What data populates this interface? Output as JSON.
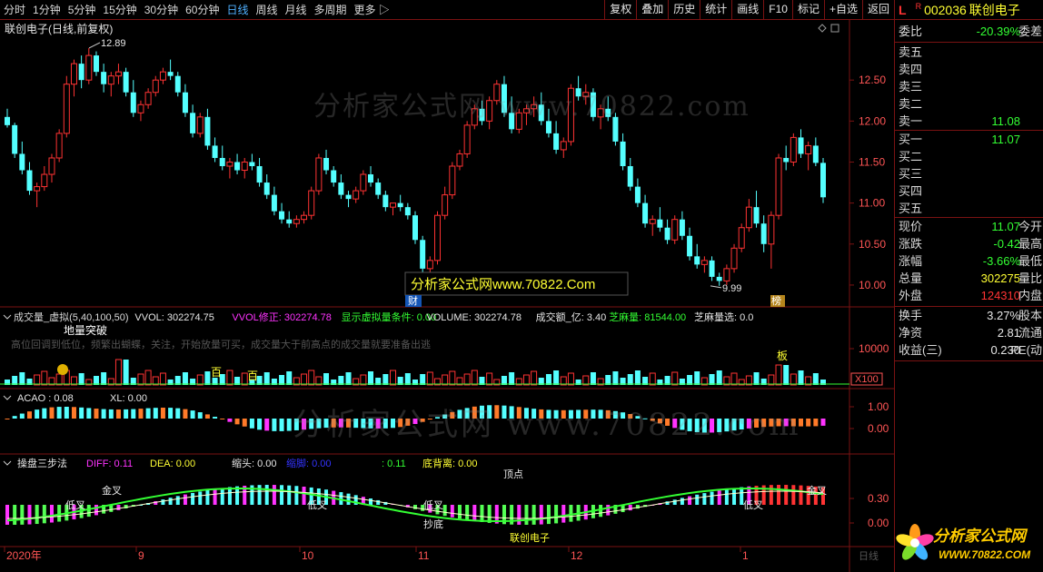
{
  "toolbar": {
    "periods": [
      "分时",
      "1分钟",
      "5分钟",
      "15分钟",
      "30分钟",
      "60分钟",
      "日线",
      "周线",
      "月线",
      "多周期",
      "更多 ▷"
    ],
    "active_period": "日线",
    "tools": [
      "复权",
      "叠加",
      "历史",
      "统计",
      "画线",
      "F10",
      "标记",
      "+自选",
      "返回"
    ]
  },
  "main": {
    "title": "联创电子(日线,前复权)",
    "high_label": "12.89",
    "low_label": "9.99",
    "price_ticks": [
      "12.50",
      "12.00",
      "11.50",
      "11.00",
      "10.50",
      "10.00"
    ],
    "banner": "分析家公式网www.70822.Com",
    "marker_cai": "财",
    "marker_bang": "榜",
    "watermark": "分析家公式网  www.70822.com"
  },
  "volume_panel": {
    "indicator_name": "成交量_虚拟(5,40,100,50)",
    "values": [
      {
        "label": "VVOL: 302274.75",
        "color": "#e6e6e6"
      },
      {
        "label": "VVOL修正: 302274.78",
        "color": "#ff33ff"
      },
      {
        "label": "显示虚拟量条件: 0.00",
        "color": "#33ff33"
      },
      {
        "label": "VOLUME: 302274.78",
        "color": "#e6e6e6"
      },
      {
        "label": "成交额_亿: 3.40",
        "color": "#e6e6e6"
      },
      {
        "label": "芝麻量: 81544.00",
        "color": "#33ff33"
      },
      {
        "label": "芝麻量选: 0.0",
        "color": "#e6e6e6"
      }
    ],
    "note": "高位回调到低位，频繁出蝴蝶，关注，开始放量可买，成交量大于前高点的成交量就要准备出逃",
    "tag_breakout": "地量突破",
    "tag_bai": "百",
    "tag_ban": "板",
    "tick_10000": "10000",
    "unit": "X100"
  },
  "acao_panel": {
    "name": "ACAO : 0.08",
    "xl": "XL: 0.00",
    "ticks": [
      "1.00",
      "0.00"
    ],
    "watermark": "分析家公式网  www.70822.com"
  },
  "macd_panel": {
    "name": "操盘三步法",
    "values": [
      {
        "label": "DIFF: 0.11",
        "color": "#ff33ff"
      },
      {
        "label": "DEA: 0.00",
        "color": "#ffff33"
      },
      {
        "label": "缩头: 0.00",
        "color": "#e6e6e6"
      },
      {
        "label": "缩脚: 0.00",
        "color": "#3333ff"
      },
      {
        "label": ": 0.11",
        "color": "#33ff33"
      },
      {
        "label": "底背离: 0.00",
        "color": "#ffff33"
      }
    ],
    "ticks": [
      "0.30",
      "0.00"
    ],
    "labels": {
      "die_cha": "低叉",
      "jin_cha": "金叉",
      "chao_di": "抄底",
      "ding": "顶点"
    },
    "stock_name": "联创电子"
  },
  "date_axis": {
    "labels": [
      "2020年",
      "9",
      "10",
      "11",
      "12",
      "1"
    ],
    "right": "日线"
  },
  "right_panel": {
    "code": "002036",
    "name": "联创电子",
    "flag_l": "L",
    "flag_r": "R",
    "weibi": {
      "label": "委比",
      "value": "-20.39%",
      "label2": "委差"
    },
    "asks": [
      {
        "label": "卖五",
        "value": ""
      },
      {
        "label": "卖四",
        "value": ""
      },
      {
        "label": "卖三",
        "value": ""
      },
      {
        "label": "卖二",
        "value": ""
      },
      {
        "label": "卖一",
        "value": "11.08"
      }
    ],
    "bids": [
      {
        "label": "买一",
        "value": "11.07"
      },
      {
        "label": "买二",
        "value": ""
      },
      {
        "label": "买三",
        "value": ""
      },
      {
        "label": "买四",
        "value": ""
      },
      {
        "label": "买五",
        "value": ""
      }
    ],
    "quote": [
      {
        "label": "现价",
        "value": "11.07",
        "label2": "今开",
        "color": "#33ff33"
      },
      {
        "label": "涨跌",
        "value": "-0.42",
        "label2": "最高",
        "color": "#33ff33"
      },
      {
        "label": "涨幅",
        "value": "-3.66%",
        "label2": "最低",
        "color": "#33ff33"
      },
      {
        "label": "总量",
        "value": "302275",
        "label2": "量比",
        "color": "#ffff33"
      },
      {
        "label": "外盘",
        "value": "124310",
        "label2": "内盘",
        "color": "#ff3333"
      }
    ],
    "fund": [
      {
        "label": "换手",
        "value": "3.27%",
        "label2": "股本",
        "color": "#e6e6e6"
      },
      {
        "label": "净资",
        "value": "2.81",
        "label2": "流通",
        "color": "#e6e6e6"
      },
      {
        "label": "收益(三)",
        "value": "0.230",
        "label2": "PE(动",
        "color": "#e6e6e6"
      }
    ],
    "logo_text": "分析家公式网",
    "logo_url": "WWW.70822.COM"
  },
  "colors": {
    "up": "#ff3333",
    "down": "#54ffff",
    "border": "#7a1212",
    "accent": "#4fb0ff"
  },
  "chart_data": {
    "type": "candlestick",
    "ylim": [
      9.8,
      13.1
    ],
    "ohlc": [
      [
        12.05,
        12.15,
        11.92,
        11.95
      ],
      [
        11.95,
        11.98,
        11.55,
        11.6
      ],
      [
        11.6,
        11.75,
        11.35,
        11.4
      ],
      [
        11.4,
        11.5,
        11.1,
        11.15
      ],
      [
        11.15,
        11.25,
        10.95,
        11.2
      ],
      [
        11.2,
        11.45,
        11.15,
        11.35
      ],
      [
        11.35,
        11.6,
        11.25,
        11.55
      ],
      [
        11.55,
        11.9,
        11.5,
        11.85
      ],
      [
        11.85,
        12.55,
        11.8,
        12.45
      ],
      [
        12.45,
        12.75,
        12.3,
        12.7
      ],
      [
        12.7,
        12.8,
        12.4,
        12.5
      ],
      [
        12.5,
        12.89,
        12.45,
        12.8
      ],
      [
        12.8,
        12.85,
        12.55,
        12.6
      ],
      [
        12.6,
        12.7,
        12.35,
        12.45
      ],
      [
        12.45,
        12.6,
        12.3,
        12.55
      ],
      [
        12.55,
        12.7,
        12.45,
        12.6
      ],
      [
        12.6,
        12.65,
        12.3,
        12.35
      ],
      [
        12.35,
        12.5,
        12.05,
        12.1
      ],
      [
        12.1,
        12.25,
        12.0,
        12.2
      ],
      [
        12.2,
        12.4,
        12.15,
        12.35
      ],
      [
        12.35,
        12.55,
        12.3,
        12.5
      ],
      [
        12.5,
        12.65,
        12.45,
        12.6
      ],
      [
        12.6,
        12.75,
        12.5,
        12.55
      ],
      [
        12.55,
        12.6,
        12.3,
        12.35
      ],
      [
        12.35,
        12.45,
        12.05,
        12.1
      ],
      [
        12.1,
        12.2,
        11.8,
        11.85
      ],
      [
        11.85,
        12.1,
        11.8,
        12.05
      ],
      [
        12.05,
        12.15,
        11.65,
        11.7
      ],
      [
        11.7,
        11.8,
        11.5,
        11.55
      ],
      [
        11.55,
        11.7,
        11.4,
        11.45
      ],
      [
        11.45,
        11.55,
        11.3,
        11.5
      ],
      [
        11.5,
        11.6,
        11.35,
        11.4
      ],
      [
        11.4,
        11.55,
        11.3,
        11.5
      ],
      [
        11.5,
        11.6,
        11.4,
        11.45
      ],
      [
        11.45,
        11.55,
        11.2,
        11.25
      ],
      [
        11.25,
        11.35,
        11.05,
        11.1
      ],
      [
        11.1,
        11.2,
        10.85,
        10.9
      ],
      [
        10.9,
        11.0,
        10.75,
        10.8
      ],
      [
        10.8,
        10.9,
        10.7,
        10.75
      ],
      [
        10.75,
        10.85,
        10.7,
        10.8
      ],
      [
        10.8,
        10.9,
        10.75,
        10.85
      ],
      [
        10.85,
        11.2,
        10.8,
        11.15
      ],
      [
        11.15,
        11.6,
        11.1,
        11.55
      ],
      [
        11.55,
        11.65,
        11.35,
        11.4
      ],
      [
        11.4,
        11.45,
        11.2,
        11.25
      ],
      [
        11.25,
        11.35,
        11.05,
        11.1
      ],
      [
        11.1,
        11.15,
        10.95,
        11.05
      ],
      [
        11.05,
        11.2,
        11.0,
        11.15
      ],
      [
        11.15,
        11.4,
        11.1,
        11.35
      ],
      [
        11.35,
        11.45,
        11.2,
        11.25
      ],
      [
        11.25,
        11.3,
        11.05,
        11.1
      ],
      [
        11.1,
        11.15,
        10.9,
        10.95
      ],
      [
        10.95,
        11.0,
        10.85,
        11.0
      ],
      [
        11.0,
        11.1,
        10.9,
        10.95
      ],
      [
        10.95,
        11.0,
        10.8,
        10.85
      ],
      [
        10.85,
        10.9,
        10.5,
        10.55
      ],
      [
        10.55,
        10.6,
        10.15,
        10.2
      ],
      [
        10.2,
        10.35,
        10.1,
        10.3
      ],
      [
        10.3,
        10.9,
        10.25,
        10.85
      ],
      [
        10.85,
        11.2,
        10.8,
        11.1
      ],
      [
        11.1,
        11.5,
        11.05,
        11.45
      ],
      [
        11.45,
        11.65,
        11.4,
        11.6
      ],
      [
        11.6,
        12.0,
        11.55,
        11.95
      ],
      [
        11.95,
        12.2,
        11.9,
        12.15
      ],
      [
        12.15,
        12.25,
        11.95,
        12.0
      ],
      [
        12.0,
        12.3,
        11.9,
        12.25
      ],
      [
        12.25,
        12.5,
        12.2,
        12.45
      ],
      [
        12.45,
        12.55,
        12.05,
        12.1
      ],
      [
        12.1,
        12.3,
        11.85,
        11.9
      ],
      [
        11.9,
        12.15,
        11.85,
        12.1
      ],
      [
        12.1,
        12.2,
        11.95,
        12.15
      ],
      [
        12.15,
        12.3,
        12.05,
        12.2
      ],
      [
        12.2,
        12.35,
        11.95,
        12.0
      ],
      [
        12.0,
        12.15,
        11.8,
        11.85
      ],
      [
        11.85,
        12.0,
        11.6,
        11.65
      ],
      [
        11.65,
        11.8,
        11.55,
        11.75
      ],
      [
        11.75,
        12.45,
        11.7,
        12.4
      ],
      [
        12.4,
        12.55,
        12.25,
        12.3
      ],
      [
        12.3,
        12.45,
        12.2,
        12.35
      ],
      [
        12.35,
        12.4,
        12.0,
        12.05
      ],
      [
        12.05,
        12.2,
        11.9,
        12.15
      ],
      [
        12.15,
        12.3,
        12.0,
        12.05
      ],
      [
        12.05,
        12.1,
        11.7,
        11.75
      ],
      [
        11.75,
        11.85,
        11.4,
        11.45
      ],
      [
        11.45,
        11.55,
        11.15,
        11.2
      ],
      [
        11.2,
        11.3,
        10.95,
        11.0
      ],
      [
        11.0,
        11.1,
        10.7,
        10.75
      ],
      [
        10.75,
        10.85,
        10.6,
        10.8
      ],
      [
        10.8,
        10.95,
        10.65,
        10.7
      ],
      [
        10.7,
        10.8,
        10.5,
        10.55
      ],
      [
        10.55,
        10.85,
        10.5,
        10.8
      ],
      [
        10.8,
        10.9,
        10.55,
        10.6
      ],
      [
        10.6,
        10.7,
        10.3,
        10.35
      ],
      [
        10.35,
        10.5,
        10.2,
        10.25
      ],
      [
        10.25,
        10.35,
        10.15,
        10.3
      ],
      [
        10.3,
        10.35,
        10.05,
        10.1
      ],
      [
        10.1,
        10.15,
        9.99,
        10.05
      ],
      [
        10.05,
        10.25,
        10.0,
        10.2
      ],
      [
        10.2,
        10.5,
        10.15,
        10.45
      ],
      [
        10.45,
        10.75,
        10.4,
        10.7
      ],
      [
        10.7,
        11.05,
        10.65,
        10.95
      ],
      [
        10.95,
        11.15,
        10.7,
        10.75
      ],
      [
        10.75,
        10.85,
        10.4,
        10.5
      ],
      [
        10.5,
        10.9,
        10.2,
        10.85
      ],
      [
        10.85,
        11.6,
        10.8,
        11.55
      ],
      [
        11.55,
        11.7,
        11.4,
        11.5
      ],
      [
        11.5,
        11.85,
        11.45,
        11.8
      ],
      [
        11.8,
        11.9,
        11.55,
        11.6
      ],
      [
        11.6,
        11.75,
        11.4,
        11.7
      ],
      [
        11.7,
        11.8,
        11.45,
        11.49
      ],
      [
        11.49,
        11.55,
        11.0,
        11.07
      ]
    ]
  }
}
